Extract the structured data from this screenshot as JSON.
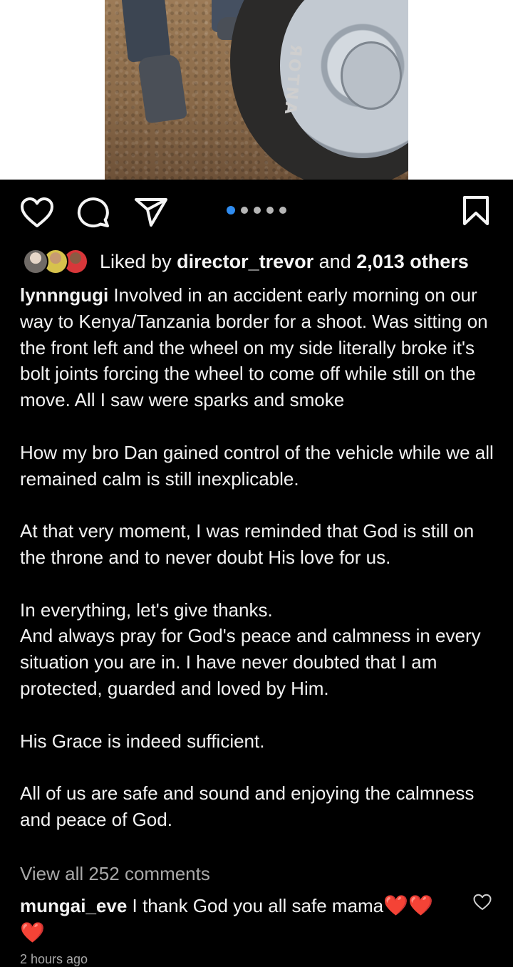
{
  "post": {
    "carousel": {
      "total": 5,
      "active_index": 0
    },
    "tire_brand_text": "ЯOTNA",
    "likes": {
      "prefix": "Liked by ",
      "user": "director_trevor",
      "middle": " and ",
      "count": "2,013 others"
    },
    "caption": {
      "username": "lynnngugi",
      "paragraphs": [
        " Involved in an accident early morning on our way to Kenya/Tanzania border for a shoot. Was sitting on the front left and the wheel on my side literally broke it's bolt joints forcing the wheel to come off while still on the move. All I saw were sparks and smoke",
        "How my bro Dan gained control of the vehicle while we all remained calm is still inexplicable.",
        "At that very moment, I was reminded that God is still on the throne and to never doubt His love for us.",
        "In everything, let's give thanks.\nAnd always pray for God's peace and calmness in every situation you are in. I have never doubted that I am protected, guarded and loved by Him.",
        "His Grace is indeed sufficient.",
        "All of us are safe and sound and enjoying the calmness and peace of God."
      ]
    },
    "view_all_comments": "View all 252 comments",
    "comment": {
      "username": "mungai_eve",
      "text": " I thank God you all safe mama",
      "emojis": "❤️❤️❤️"
    },
    "timestamp": "2 hours ago",
    "icons": {
      "like": "heart-outline-icon",
      "comment": "speech-bubble-icon",
      "share": "paper-plane-icon",
      "save": "bookmark-icon",
      "comment_like": "heart-outline-icon"
    },
    "colors": {
      "background": "#000000",
      "accent": "#2f8cf0",
      "muted": "#a8a8a8"
    }
  }
}
